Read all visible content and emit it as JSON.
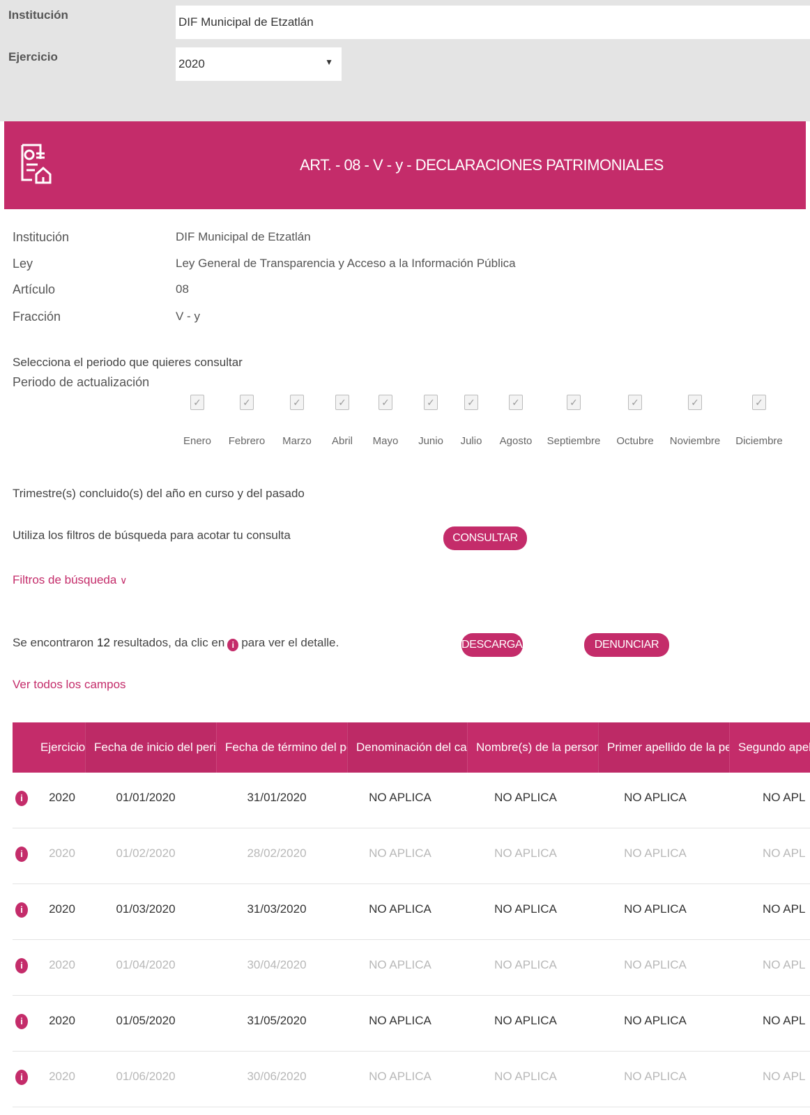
{
  "top_filter": {
    "institucion_label": "Institución",
    "institucion_value": "DIF Municipal de Etzatlán",
    "ejercicio_label": "Ejercicio",
    "ejercicio_value": "2020"
  },
  "banner": {
    "title": "ART. - 08 - V - y - DECLARACIONES PATRIMONIALES",
    "icon": "document-home-icon",
    "color": "#c42c6a"
  },
  "info": {
    "institucion_label": "Institución",
    "institucion_value": "DIF Municipal de Etzatlán",
    "ley_label": "Ley",
    "ley_value": "Ley General de Transparencia y Acceso a la Información Pública",
    "articulo_label": "Artículo",
    "articulo_value": "08",
    "fraccion_label": "Fracción",
    "fraccion_value": "V - y"
  },
  "period": {
    "prompt": "Selecciona el periodo que quieres consultar",
    "label": "Periodo de actualización",
    "months": [
      "Enero",
      "Febrero",
      "Marzo",
      "Abril",
      "Mayo",
      "Junio",
      "Julio",
      "Agosto",
      "Septiembre",
      "Octubre",
      "Noviembre",
      "Diciembre"
    ],
    "checked": true
  },
  "trimestre_text": "Trimestre(s) concluido(s) del año en curso y del pasado",
  "filter_hint": "Utiliza los filtros de búsqueda para acotar tu consulta",
  "consultar_button": "CONSULTAR",
  "filtros_link": "Filtros de búsqueda",
  "results": {
    "prefix": "Se encontraron",
    "count": "12",
    "middle": "resultados, da clic en",
    "suffix": "para ver el detalle."
  },
  "descargar_button": "DESCARGAR",
  "denunciar_button": "DENUNCIAR",
  "ver_todos_link": "Ver todos los campos",
  "table": {
    "headers": [
      "Ejercicio",
      "Fecha de inicio del perio...",
      "Fecha de término del per...",
      "Denominación del cargo",
      "Nombre(s) de la persona...",
      "Primer apellido de la per...",
      "Segundo apellid"
    ],
    "rows": [
      [
        "2020",
        "01/01/2020",
        "31/01/2020",
        "NO APLICA",
        "NO APLICA",
        "NO APLICA",
        "NO APL"
      ],
      [
        "2020",
        "01/02/2020",
        "28/02/2020",
        "NO APLICA",
        "NO APLICA",
        "NO APLICA",
        "NO APL"
      ],
      [
        "2020",
        "01/03/2020",
        "31/03/2020",
        "NO APLICA",
        "NO APLICA",
        "NO APLICA",
        "NO APL"
      ],
      [
        "2020",
        "01/04/2020",
        "30/04/2020",
        "NO APLICA",
        "NO APLICA",
        "NO APLICA",
        "NO APL"
      ],
      [
        "2020",
        "01/05/2020",
        "31/05/2020",
        "NO APLICA",
        "NO APLICA",
        "NO APLICA",
        "NO APL"
      ],
      [
        "2020",
        "01/06/2020",
        "30/06/2020",
        "NO APLICA",
        "NO APLICA",
        "NO APLICA",
        "NO APL"
      ]
    ]
  },
  "accent_color": "#c42c6a"
}
